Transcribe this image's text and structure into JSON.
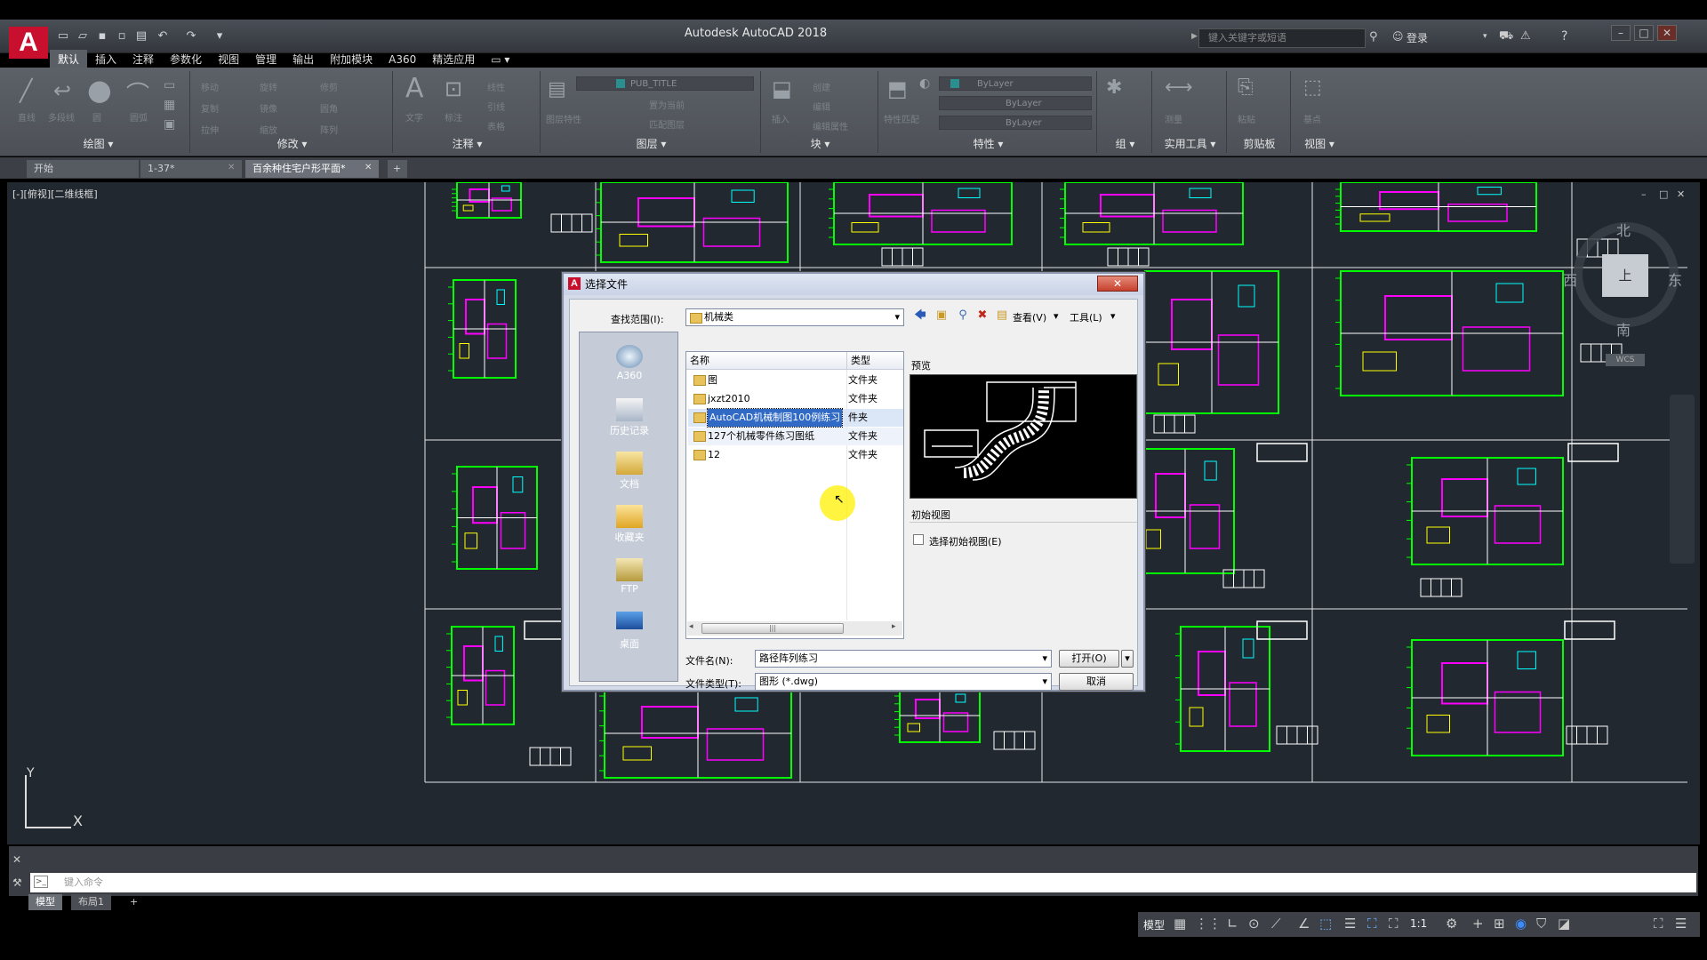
{
  "app": {
    "title": "Autodesk AutoCAD 2018",
    "logo": "A",
    "search_placeholder": "键入关键字或短语",
    "login_label": "登录"
  },
  "ribbon_tabs": [
    "默认",
    "插入",
    "注释",
    "参数化",
    "视图",
    "管理",
    "输出",
    "附加模块",
    "A360",
    "精选应用"
  ],
  "ribbon_panels": [
    {
      "label": "绘图 ▾"
    },
    {
      "label": "修改 ▾"
    },
    {
      "label": "注释 ▾"
    },
    {
      "label": "图层 ▾"
    },
    {
      "label": "块 ▾"
    },
    {
      "label": "特性 ▾"
    },
    {
      "label": "组 ▾"
    },
    {
      "label": "实用工具 ▾"
    },
    {
      "label": "剪贴板"
    },
    {
      "label": "视图 ▾"
    }
  ],
  "ribbon_ghost": {
    "draw": [
      "直线",
      "多段线",
      "圆",
      "圆弧"
    ],
    "modify": [
      "移动",
      "旋转",
      "修剪",
      "复制",
      "镜像",
      "圆角",
      "拉伸",
      "缩放",
      "阵列"
    ],
    "annotate": [
      "文字",
      "标注",
      "线性",
      "引线",
      "表格"
    ],
    "layer_combo": "PUB_TITLE",
    "layer_tools": [
      "图层特性",
      "置为当前",
      "匹配图层"
    ],
    "block": [
      "插入",
      "创建",
      "编辑",
      "编辑属性"
    ],
    "props": [
      "特性匹配",
      "ByLayer",
      "ByLayer",
      "ByLayer"
    ],
    "utils": [
      "测量"
    ],
    "clip": [
      "粘贴"
    ],
    "view": [
      "基点"
    ]
  },
  "doc_tabs": [
    {
      "label": "开始",
      "active": false
    },
    {
      "label": "1-37*",
      "active": false
    },
    {
      "label": "百余种住宅户形平面*",
      "active": true
    }
  ],
  "viewport_label": "[-][俯视][二维线框]",
  "viewcube": {
    "n": "北",
    "s": "南",
    "e": "东",
    "w": "西",
    "top": "上",
    "wcs": "WCS"
  },
  "ucs": {
    "x": "X",
    "y": "Y"
  },
  "command": {
    "placeholder": "键入命令"
  },
  "layout_tabs": [
    "模型",
    "布局1",
    "+"
  ],
  "status": {
    "model": "模型",
    "scale": "1:1"
  },
  "dialog": {
    "title": "选择文件",
    "look_in_label": "查找范围(I):",
    "look_in_value": "机械类",
    "view_label": "查看(V)",
    "tools_label": "工具(L)",
    "places": [
      "A360",
      "历史记录",
      "文档",
      "收藏夹",
      "FTP",
      "桌面"
    ],
    "columns": [
      "名称",
      "类型"
    ],
    "files": [
      {
        "name": "图",
        "type": "文件夹",
        "selected": false
      },
      {
        "name": "jxzt2010",
        "type": "文件夹",
        "selected": false
      },
      {
        "name": "AutoCAD机械制图100例练习",
        "type": "件夹",
        "selected": true
      },
      {
        "name": "127个机械零件练习图纸",
        "type": "文件夹",
        "selected": false
      },
      {
        "name": "12",
        "type": "文件夹",
        "selected": false
      }
    ],
    "preview_label": "预览",
    "initial_view_label": "初始视图",
    "initial_view_checkbox": "选择初始视图(E)",
    "filename_label": "文件名(N):",
    "filename_value": "路径阵列练习",
    "filetype_label": "文件类型(T):",
    "filetype_value": "图形 (*.dwg)",
    "open_button": "打开(O)",
    "cancel_button": "取消"
  },
  "colors": {
    "canvas": "#212830",
    "cad_green": "#00ff00",
    "cad_magenta": "#ff00ff",
    "cad_white": "#ffffff",
    "cad_yellow": "#ffff00",
    "cad_cyan": "#00ffff",
    "selection": "#316ac5"
  }
}
